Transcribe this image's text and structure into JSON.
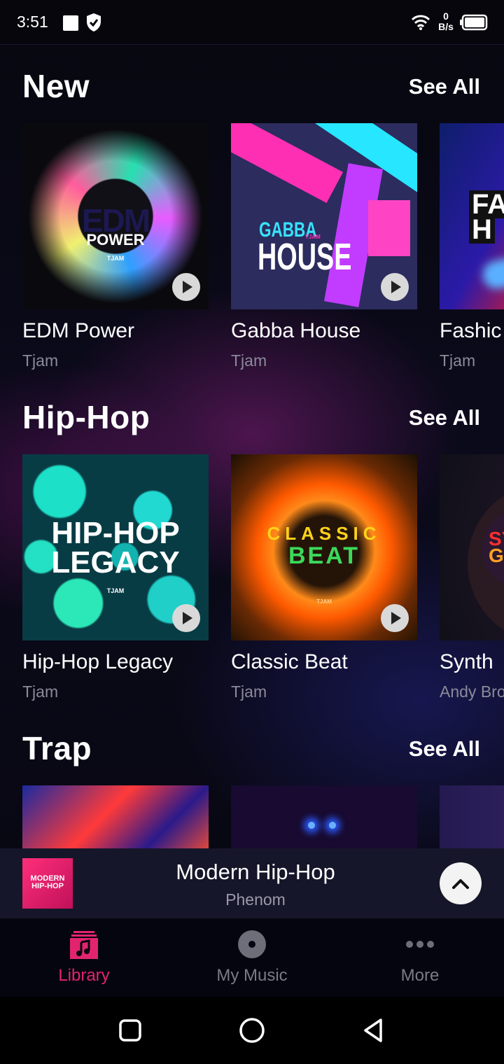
{
  "status_bar": {
    "time": "3:51",
    "speed_value": "0",
    "speed_unit": "B/s",
    "icons": [
      "square-notification-icon",
      "shield-icon",
      "wifi-icon",
      "battery-icon"
    ]
  },
  "sections": [
    {
      "title": "New",
      "see_all": "See All",
      "items": [
        {
          "name": "EDM Power",
          "artist": "Tjam",
          "art_text": [
            "EDM",
            "POWER",
            "TJAM"
          ]
        },
        {
          "name": "Gabba House",
          "artist": "Tjam",
          "art_text": [
            "GABBA",
            "HOUSE",
            "TJAM"
          ]
        },
        {
          "name": "Fashic",
          "artist": "Tjam",
          "art_text": [
            "FA",
            "H"
          ]
        }
      ]
    },
    {
      "title": "Hip-Hop",
      "see_all": "See All",
      "items": [
        {
          "name": "Hip-Hop Legacy",
          "artist": "Tjam",
          "art_text": [
            "HIP-HOP",
            "LEGACY",
            "TJAM"
          ]
        },
        {
          "name": "Classic Beat",
          "artist": "Tjam",
          "art_text": [
            "CLASSIC",
            "BEAT",
            "TJAM"
          ]
        },
        {
          "name": "Synth",
          "artist": "Andy Bro",
          "art_text": [
            "SY",
            "GI"
          ]
        }
      ]
    },
    {
      "title": "Trap",
      "see_all": "See All",
      "items": []
    }
  ],
  "mini_player": {
    "title": "Modern Hip-Hop",
    "artist": "Phenom",
    "thumb_text": "MODERN HIP-HOP"
  },
  "tabs": [
    {
      "label": "Library",
      "icon": "music-library-icon",
      "active": true
    },
    {
      "label": "My Music",
      "icon": "disc-icon",
      "active": false
    },
    {
      "label": "More",
      "icon": "more-dots-icon",
      "active": false
    }
  ],
  "colors": {
    "accent": "#e2246e",
    "background": "#07070f",
    "muted_text": "#8a8a9a"
  }
}
